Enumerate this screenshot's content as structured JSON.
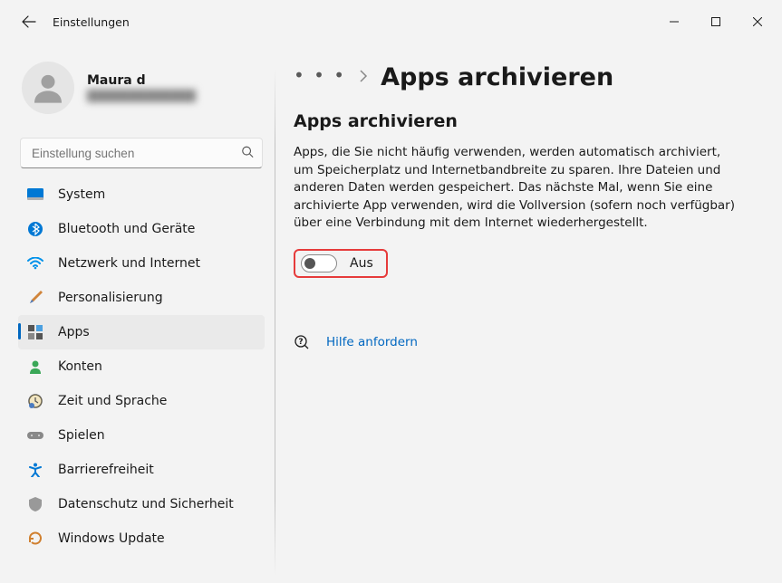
{
  "window": {
    "title": "Einstellungen"
  },
  "profile": {
    "name": "Maura d",
    "email": "█████████████"
  },
  "search": {
    "placeholder": "Einstellung suchen"
  },
  "nav": {
    "items": [
      {
        "key": "system",
        "label": "System"
      },
      {
        "key": "bluetooth",
        "label": "Bluetooth und Geräte"
      },
      {
        "key": "network",
        "label": "Netzwerk und Internet"
      },
      {
        "key": "personalisation",
        "label": "Personalisierung"
      },
      {
        "key": "apps",
        "label": "Apps"
      },
      {
        "key": "accounts",
        "label": "Konten"
      },
      {
        "key": "time",
        "label": "Zeit und Sprache"
      },
      {
        "key": "gaming",
        "label": "Spielen"
      },
      {
        "key": "accessibility",
        "label": "Barrierefreiheit"
      },
      {
        "key": "privacy",
        "label": "Datenschutz und Sicherheit"
      },
      {
        "key": "update",
        "label": "Windows Update"
      }
    ],
    "selected": "apps"
  },
  "breadcrumb": {
    "dots": "• • •",
    "page_title": "Apps archivieren"
  },
  "section": {
    "title": "Apps archivieren",
    "description": "Apps, die Sie nicht häufig verwenden, werden automatisch archiviert, um Speicherplatz und Internetbandbreite zu sparen. Ihre Dateien und anderen Daten werden gespeichert. Das nächste Mal, wenn Sie eine archivierte App verwenden, wird die Vollversion (sofern noch verfügbar) über eine Verbindung mit dem Internet wiederhergestellt.",
    "toggle_state": "Aus"
  },
  "help": {
    "label": "Hilfe anfordern"
  }
}
